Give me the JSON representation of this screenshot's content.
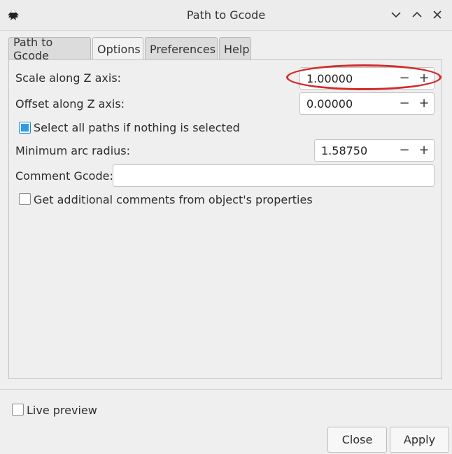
{
  "window": {
    "title": "Path to Gcode"
  },
  "icons": {
    "app": "inkscape-icon",
    "minimize": "chevron-down-icon",
    "maximize": "chevron-up-icon",
    "close": "close-icon"
  },
  "tabs": [
    {
      "label": "Path to Gcode",
      "active": false
    },
    {
      "label": "Options",
      "active": true
    },
    {
      "label": "Preferences",
      "active": false
    },
    {
      "label": "Help",
      "active": false
    }
  ],
  "options": {
    "scale_z": {
      "label": "Scale along Z axis:",
      "value": "1.00000",
      "minus": "−",
      "plus": "+"
    },
    "offset_z": {
      "label": "Offset along Z axis:",
      "value": "0.00000",
      "minus": "−",
      "plus": "+"
    },
    "select_all": {
      "label": "Select all paths if nothing is selected",
      "checked": true
    },
    "min_arc": {
      "label": "Minimum arc radius:",
      "value": "1.58750",
      "minus": "−",
      "plus": "+"
    },
    "comment_gcode": {
      "label": "Comment Gcode:",
      "value": ""
    },
    "additional_comments": {
      "label": "Get additional comments from object's properties",
      "checked": false
    }
  },
  "footer": {
    "live_preview": {
      "label": "Live preview",
      "checked": false
    },
    "close_label": "Close",
    "apply_label": "Apply"
  },
  "colors": {
    "highlight_ring": "#d42a2a",
    "checkbox_accent": "#2e9be6"
  }
}
